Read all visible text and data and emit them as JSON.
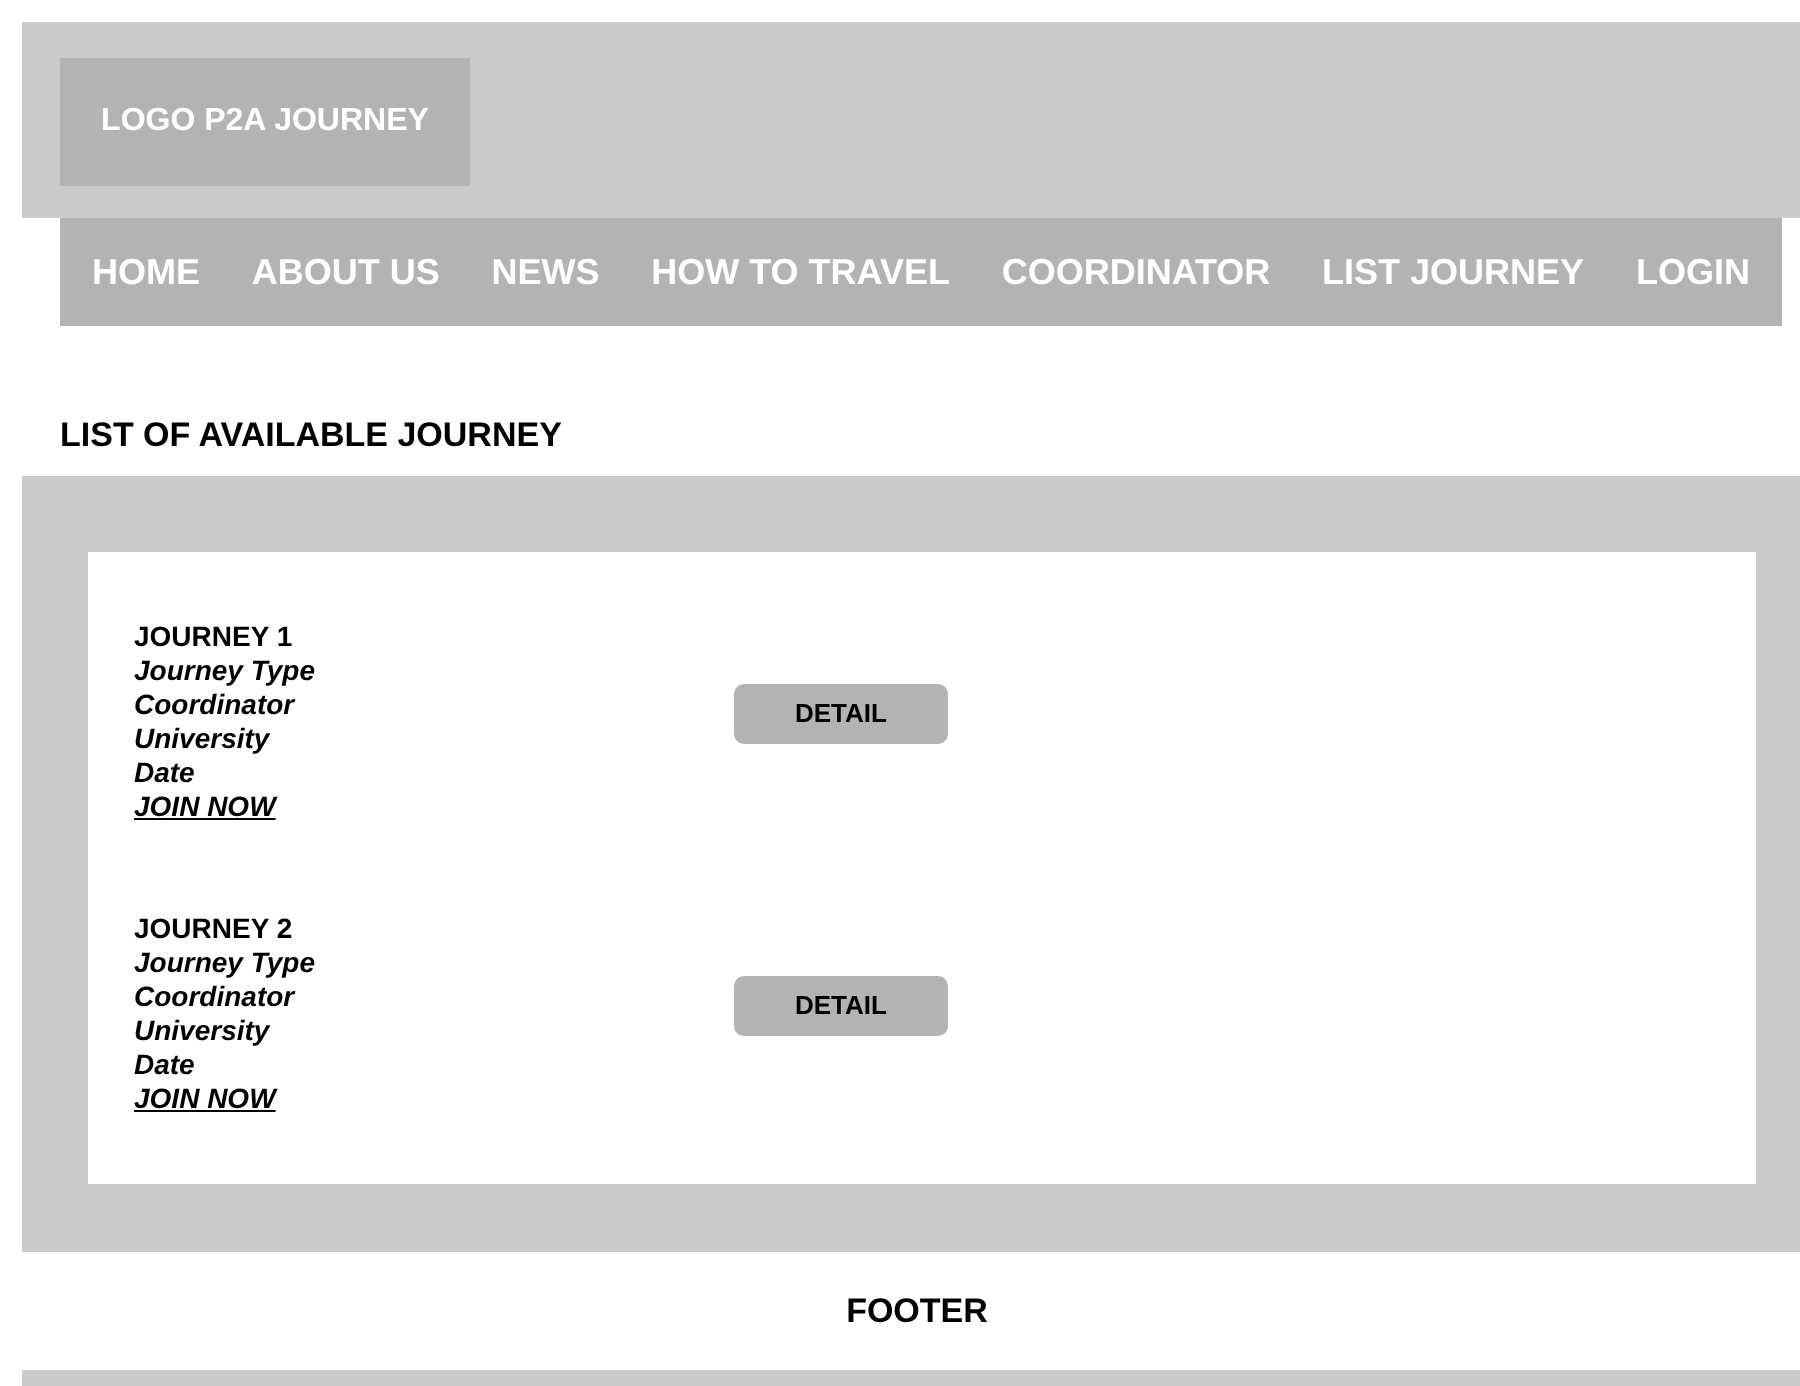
{
  "logo": "LOGO P2A JOURNEY",
  "nav": [
    {
      "label": "HOME"
    },
    {
      "label": "ABOUT US"
    },
    {
      "label": "NEWS"
    },
    {
      "label": "HOW TO TRAVEL"
    },
    {
      "label": "COORDINATOR"
    },
    {
      "label": "LIST JOURNEY"
    },
    {
      "label": "LOGIN"
    }
  ],
  "heading": "LIST OF AVAILABLE JOURNEY",
  "journeys": [
    {
      "title": "JOURNEY 1",
      "details": [
        "Journey Type",
        "Coordinator",
        "University",
        "Date"
      ],
      "link": "JOIN NOW",
      "button": "DETAIL"
    },
    {
      "title": "JOURNEY 2",
      "details": [
        "Journey Type",
        "Coordinator",
        "University",
        "Date"
      ],
      "link": "JOIN NOW",
      "button": "DETAIL"
    }
  ],
  "footer": "FOOTER"
}
